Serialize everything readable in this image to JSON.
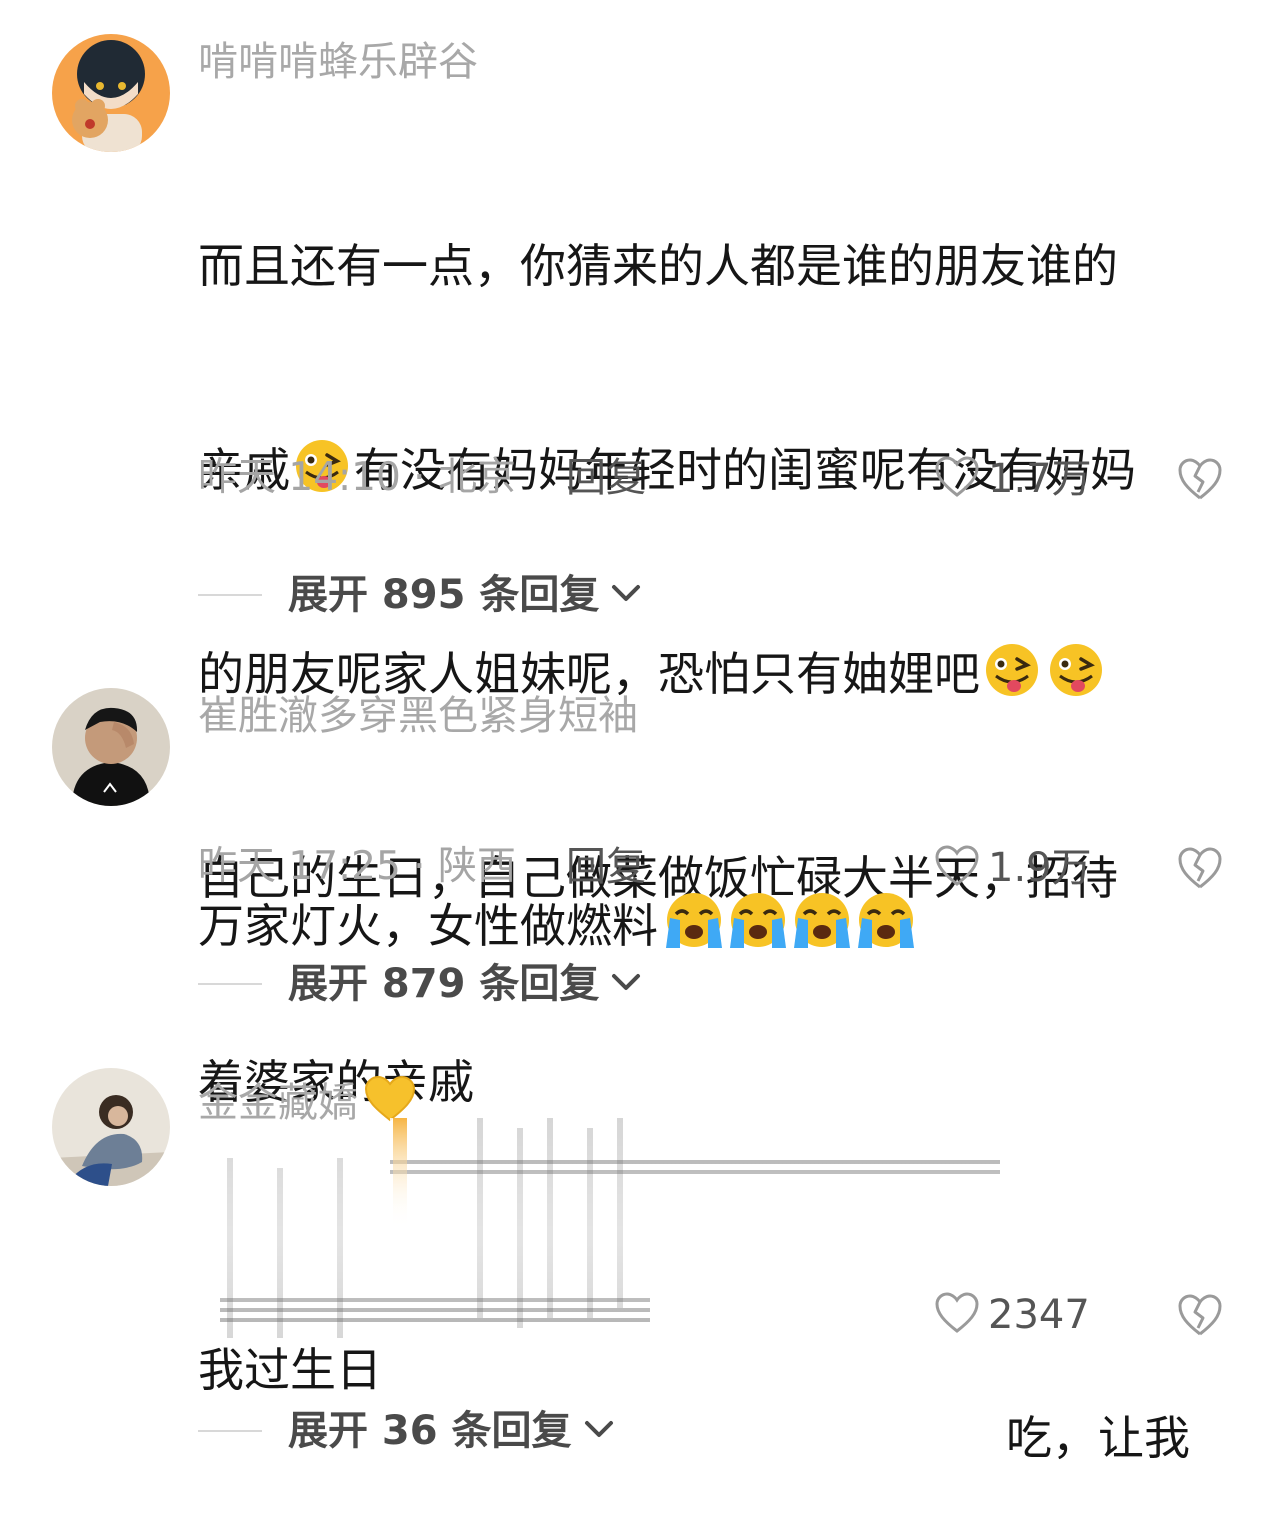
{
  "comments": [
    {
      "username": "啃啃啃蜂乐辟谷",
      "text_lines": [
        "而且还有一点，你猜来的人都是谁的朋友谁的",
        "亲戚",
        "有没有妈妈年轻时的闺蜜呢有没有妈妈",
        "的朋友呢家人姐妹呢，恐怕只有妯娌吧",
        "自己的生日，自己做菜做饭忙碌大半天，招待",
        "着婆家的亲戚"
      ],
      "emoji": "winking-tongue-emoji",
      "time_location": "昨天 14:10 · 北京",
      "reply_label": "回复",
      "likes": "1.7万",
      "expand_label": "展开 895 条回复"
    },
    {
      "username": "崔胜澈多穿黑色紧身短袖",
      "text": "万家灯火，女性做燃料",
      "emoji": "loudly-crying-emoji",
      "time_location": "昨天 17:25 · 陕西",
      "reply_label": "回复",
      "likes": "1.9万",
      "expand_label": "展开 879 条回复"
    },
    {
      "username": "金金藏嬌",
      "text_start": "我过生日",
      "text_end": "吃，让我",
      "likes": "2347",
      "expand_label": "展开 36 条回复"
    }
  ],
  "colors": {
    "username": "#a8a8a8",
    "text": "#161616",
    "meta": "#a5a5a5",
    "action": "#555555",
    "emoji_yellow": "#f7c325"
  }
}
